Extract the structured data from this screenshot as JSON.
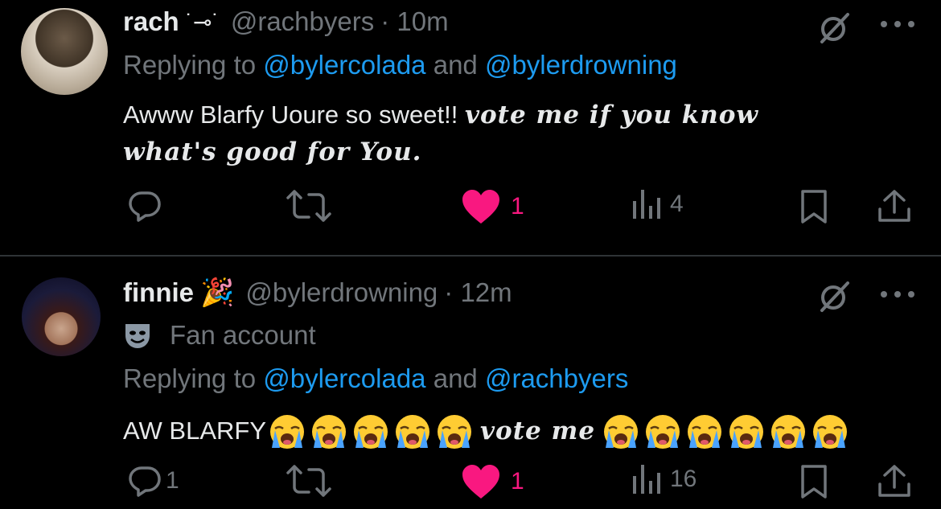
{
  "tweets": [
    {
      "name": "rach",
      "name_deco": "˙⊸˙",
      "handle": "@rachbyers",
      "time": "· 10m",
      "replying_prefix": "Replying to ",
      "replying_to_1": "@bylercolada",
      "replying_and": " and ",
      "replying_to_2": "@bylerdrowning",
      "text_plain": "Awww Blarfy Uoure so sweet!! ",
      "text_script_1": "vote me if you know",
      "text_script_2": "what's good for You.",
      "reply_count": "",
      "like_count": "1",
      "view_count": "4"
    },
    {
      "name": "finnie",
      "name_emoji": "🎉",
      "handle": "@bylerdrowning",
      "time": "· 12m",
      "label": "Fan account",
      "replying_prefix": "Replying to ",
      "replying_to_1": "@bylercolada",
      "replying_and": " and ",
      "replying_to_2": "@rachbyers",
      "text_plain": "AW BLARFY",
      "text_script": "vote me",
      "reply_count": "1",
      "like_count": "1",
      "view_count": "16"
    }
  ],
  "colors": {
    "like": "#f91880",
    "link": "#1d9bf0",
    "muted": "#71767b",
    "text": "#e7e9ea"
  },
  "icons": [
    "grok-icon",
    "more-icon",
    "reply-icon",
    "retweet-icon",
    "like-icon",
    "views-icon",
    "bookmark-icon",
    "share-icon",
    "crying-emoji-icon",
    "mask-icon"
  ]
}
